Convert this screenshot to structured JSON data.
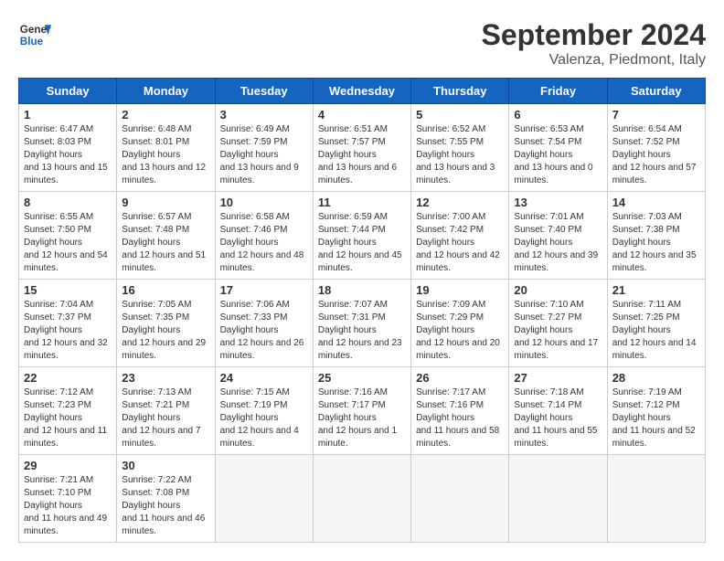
{
  "header": {
    "logo_line1": "General",
    "logo_line2": "Blue",
    "month": "September 2024",
    "location": "Valenza, Piedmont, Italy"
  },
  "weekdays": [
    "Sunday",
    "Monday",
    "Tuesday",
    "Wednesday",
    "Thursday",
    "Friday",
    "Saturday"
  ],
  "weeks": [
    [
      {
        "day": "1",
        "rise": "6:47 AM",
        "set": "8:03 PM",
        "hours": "13 hours and 15 minutes."
      },
      {
        "day": "2",
        "rise": "6:48 AM",
        "set": "8:01 PM",
        "hours": "13 hours and 12 minutes."
      },
      {
        "day": "3",
        "rise": "6:49 AM",
        "set": "7:59 PM",
        "hours": "13 hours and 9 minutes."
      },
      {
        "day": "4",
        "rise": "6:51 AM",
        "set": "7:57 PM",
        "hours": "13 hours and 6 minutes."
      },
      {
        "day": "5",
        "rise": "6:52 AM",
        "set": "7:55 PM",
        "hours": "13 hours and 3 minutes."
      },
      {
        "day": "6",
        "rise": "6:53 AM",
        "set": "7:54 PM",
        "hours": "13 hours and 0 minutes."
      },
      {
        "day": "7",
        "rise": "6:54 AM",
        "set": "7:52 PM",
        "hours": "12 hours and 57 minutes."
      }
    ],
    [
      {
        "day": "8",
        "rise": "6:55 AM",
        "set": "7:50 PM",
        "hours": "12 hours and 54 minutes."
      },
      {
        "day": "9",
        "rise": "6:57 AM",
        "set": "7:48 PM",
        "hours": "12 hours and 51 minutes."
      },
      {
        "day": "10",
        "rise": "6:58 AM",
        "set": "7:46 PM",
        "hours": "12 hours and 48 minutes."
      },
      {
        "day": "11",
        "rise": "6:59 AM",
        "set": "7:44 PM",
        "hours": "12 hours and 45 minutes."
      },
      {
        "day": "12",
        "rise": "7:00 AM",
        "set": "7:42 PM",
        "hours": "12 hours and 42 minutes."
      },
      {
        "day": "13",
        "rise": "7:01 AM",
        "set": "7:40 PM",
        "hours": "12 hours and 39 minutes."
      },
      {
        "day": "14",
        "rise": "7:03 AM",
        "set": "7:38 PM",
        "hours": "12 hours and 35 minutes."
      }
    ],
    [
      {
        "day": "15",
        "rise": "7:04 AM",
        "set": "7:37 PM",
        "hours": "12 hours and 32 minutes."
      },
      {
        "day": "16",
        "rise": "7:05 AM",
        "set": "7:35 PM",
        "hours": "12 hours and 29 minutes."
      },
      {
        "day": "17",
        "rise": "7:06 AM",
        "set": "7:33 PM",
        "hours": "12 hours and 26 minutes."
      },
      {
        "day": "18",
        "rise": "7:07 AM",
        "set": "7:31 PM",
        "hours": "12 hours and 23 minutes."
      },
      {
        "day": "19",
        "rise": "7:09 AM",
        "set": "7:29 PM",
        "hours": "12 hours and 20 minutes."
      },
      {
        "day": "20",
        "rise": "7:10 AM",
        "set": "7:27 PM",
        "hours": "12 hours and 17 minutes."
      },
      {
        "day": "21",
        "rise": "7:11 AM",
        "set": "7:25 PM",
        "hours": "12 hours and 14 minutes."
      }
    ],
    [
      {
        "day": "22",
        "rise": "7:12 AM",
        "set": "7:23 PM",
        "hours": "12 hours and 11 minutes."
      },
      {
        "day": "23",
        "rise": "7:13 AM",
        "set": "7:21 PM",
        "hours": "12 hours and 7 minutes."
      },
      {
        "day": "24",
        "rise": "7:15 AM",
        "set": "7:19 PM",
        "hours": "12 hours and 4 minutes."
      },
      {
        "day": "25",
        "rise": "7:16 AM",
        "set": "7:17 PM",
        "hours": "12 hours and 1 minute."
      },
      {
        "day": "26",
        "rise": "7:17 AM",
        "set": "7:16 PM",
        "hours": "11 hours and 58 minutes."
      },
      {
        "day": "27",
        "rise": "7:18 AM",
        "set": "7:14 PM",
        "hours": "11 hours and 55 minutes."
      },
      {
        "day": "28",
        "rise": "7:19 AM",
        "set": "7:12 PM",
        "hours": "11 hours and 52 minutes."
      }
    ],
    [
      {
        "day": "29",
        "rise": "7:21 AM",
        "set": "7:10 PM",
        "hours": "11 hours and 49 minutes."
      },
      {
        "day": "30",
        "rise": "7:22 AM",
        "set": "7:08 PM",
        "hours": "11 hours and 46 minutes."
      },
      null,
      null,
      null,
      null,
      null
    ]
  ]
}
